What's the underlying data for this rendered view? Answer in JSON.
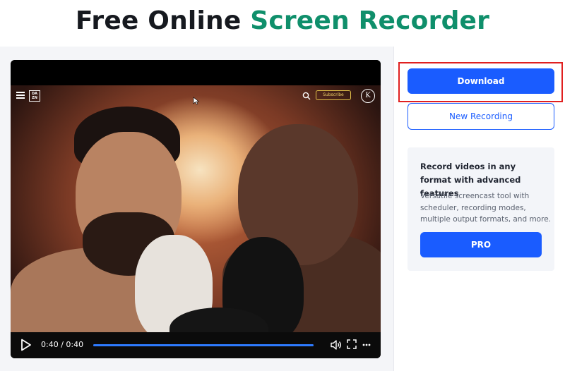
{
  "header": {
    "title_part1": "Free Online",
    "title_part2": "Screen Recorder",
    "accent_color": "#0f8f6b"
  },
  "video": {
    "app_logo_text": "DA ZN",
    "subscribe_label": "Subscribe",
    "avatar_letter": "K",
    "time_display": "0:40 / 0:40",
    "progress": 1.0,
    "icons": [
      "menu-icon",
      "search-icon",
      "play-icon",
      "volume-icon",
      "fullscreen-icon",
      "more-icon"
    ]
  },
  "sidebar": {
    "download_label": "Download",
    "new_recording_label": "New Recording",
    "promo": {
      "heading": "Record videos in any format with advanced features",
      "text": "Versatile screencast tool with scheduler, recording modes, multiple output formats, and more.",
      "button_label": "PRO"
    },
    "primary_color": "#1a5cff",
    "highlight_color": "#e02020"
  }
}
